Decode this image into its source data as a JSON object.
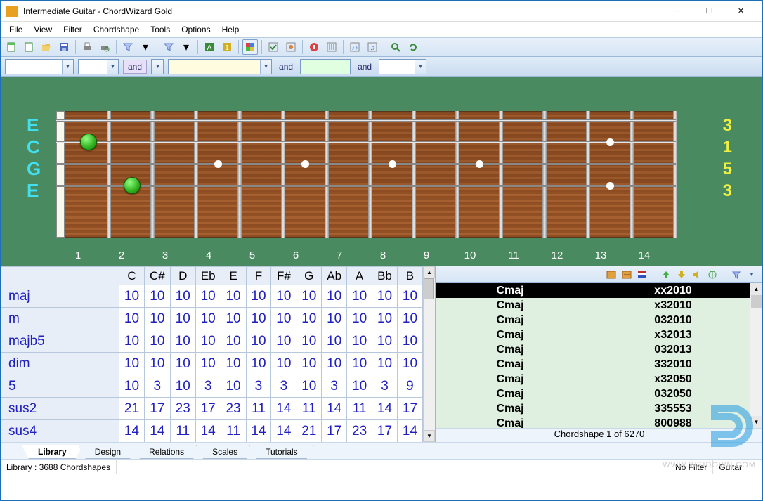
{
  "title": "Intermediate Guitar - ChordWizard Gold",
  "menu": [
    "File",
    "View",
    "Filter",
    "Chordshape",
    "Tools",
    "Options",
    "Help"
  ],
  "filter": {
    "and": "and"
  },
  "fretboard": {
    "string_labels": [
      "E",
      "C",
      "G",
      "E"
    ],
    "right_labels": [
      "3",
      "1",
      "5",
      "3"
    ],
    "fret_numbers": [
      "1",
      "2",
      "3",
      "4",
      "5",
      "6",
      "7",
      "8",
      "9",
      "10",
      "11",
      "12",
      "13",
      "14"
    ]
  },
  "grid": {
    "headers": [
      "",
      "C",
      "C#",
      "D",
      "Eb",
      "E",
      "F",
      "F#",
      "G",
      "Ab",
      "A",
      "Bb",
      "B"
    ],
    "rows": [
      {
        "name": "maj",
        "vals": [
          "10",
          "10",
          "10",
          "10",
          "10",
          "10",
          "10",
          "10",
          "10",
          "10",
          "10",
          "10"
        ]
      },
      {
        "name": "m",
        "vals": [
          "10",
          "10",
          "10",
          "10",
          "10",
          "10",
          "10",
          "10",
          "10",
          "10",
          "10",
          "10"
        ]
      },
      {
        "name": "majb5",
        "vals": [
          "10",
          "10",
          "10",
          "10",
          "10",
          "10",
          "10",
          "10",
          "10",
          "10",
          "10",
          "10"
        ]
      },
      {
        "name": "dim",
        "vals": [
          "10",
          "10",
          "10",
          "10",
          "10",
          "10",
          "10",
          "10",
          "10",
          "10",
          "10",
          "10"
        ]
      },
      {
        "name": "5",
        "vals": [
          "10",
          "3",
          "10",
          "3",
          "10",
          "3",
          "3",
          "10",
          "3",
          "10",
          "3",
          "9"
        ]
      },
      {
        "name": "sus2",
        "vals": [
          "21",
          "17",
          "23",
          "17",
          "23",
          "11",
          "14",
          "11",
          "14",
          "11",
          "14",
          "17"
        ]
      },
      {
        "name": "sus4",
        "vals": [
          "14",
          "14",
          "11",
          "14",
          "11",
          "14",
          "14",
          "21",
          "17",
          "23",
          "17",
          "14"
        ]
      }
    ]
  },
  "chordlist": {
    "counter": "Chordshape 1 of 6270",
    "rows": [
      {
        "name": "Cmaj",
        "pattern": "xx2010",
        "sel": true
      },
      {
        "name": "Cmaj",
        "pattern": "x32010"
      },
      {
        "name": "Cmaj",
        "pattern": "032010"
      },
      {
        "name": "Cmaj",
        "pattern": "x32013"
      },
      {
        "name": "Cmaj",
        "pattern": "032013"
      },
      {
        "name": "Cmaj",
        "pattern": "332010"
      },
      {
        "name": "Cmaj",
        "pattern": "x32050"
      },
      {
        "name": "Cmaj",
        "pattern": "032050"
      },
      {
        "name": "Cmaj",
        "pattern": "335553"
      },
      {
        "name": "Cmaj",
        "pattern": "800988"
      }
    ]
  },
  "tabs": [
    "Library",
    "Design",
    "Relations",
    "Scales",
    "Tutorials"
  ],
  "status": {
    "left": "Library :  3688 Chordshapes",
    "nofilter": "No Filter",
    "instrument": "Guitar"
  },
  "watermark": "WWW.WEIDOWN.COM"
}
